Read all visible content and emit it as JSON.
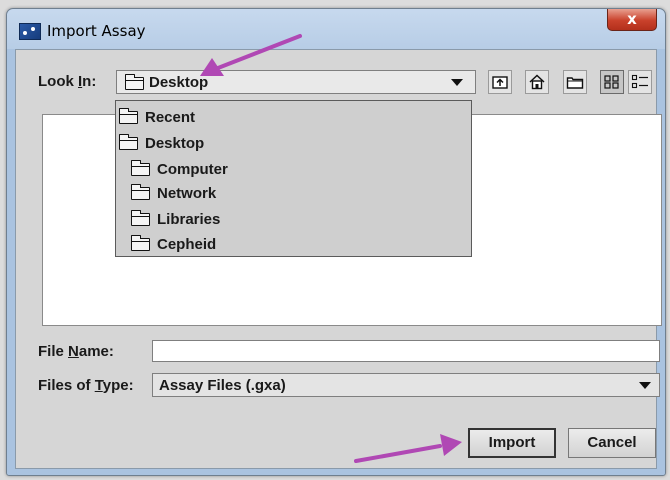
{
  "window": {
    "title": "Import Assay",
    "close_symbol": "x",
    "accent": "#aac3e0"
  },
  "look_in": {
    "label_before": "Look ",
    "label_mnemonic": "I",
    "label_after": "n:",
    "value": "Desktop",
    "icon": "folder-icon"
  },
  "toolbar": {
    "buttons": [
      {
        "name": "up-one-level-button",
        "icon": "up-folder-icon"
      },
      {
        "name": "home-button",
        "icon": "home-icon"
      },
      {
        "name": "new-folder-button",
        "icon": "new-folder-icon"
      },
      {
        "name": "list-view-button",
        "icon": "list-icon",
        "active": true
      },
      {
        "name": "details-view-button",
        "icon": "details-icon"
      }
    ]
  },
  "dropdown": {
    "items": [
      {
        "label": "Recent",
        "level": 0
      },
      {
        "label": "Desktop",
        "level": 0
      },
      {
        "label": "Computer",
        "level": 1
      },
      {
        "label": "Network",
        "level": 1
      },
      {
        "label": "Libraries",
        "level": 1
      },
      {
        "label": "Cepheid",
        "level": 1
      }
    ]
  },
  "file_name": {
    "label_before": "File ",
    "label_mnemonic": "N",
    "label_after": "ame:",
    "value": ""
  },
  "file_type": {
    "label_before": "Files of ",
    "label_mnemonic": "T",
    "label_after": "ype:",
    "value": "Assay Files (.gxa)"
  },
  "buttons": {
    "import_label": "Import",
    "cancel_label": "Cancel"
  },
  "annotation": {
    "arrow_color": "#b048b4"
  }
}
